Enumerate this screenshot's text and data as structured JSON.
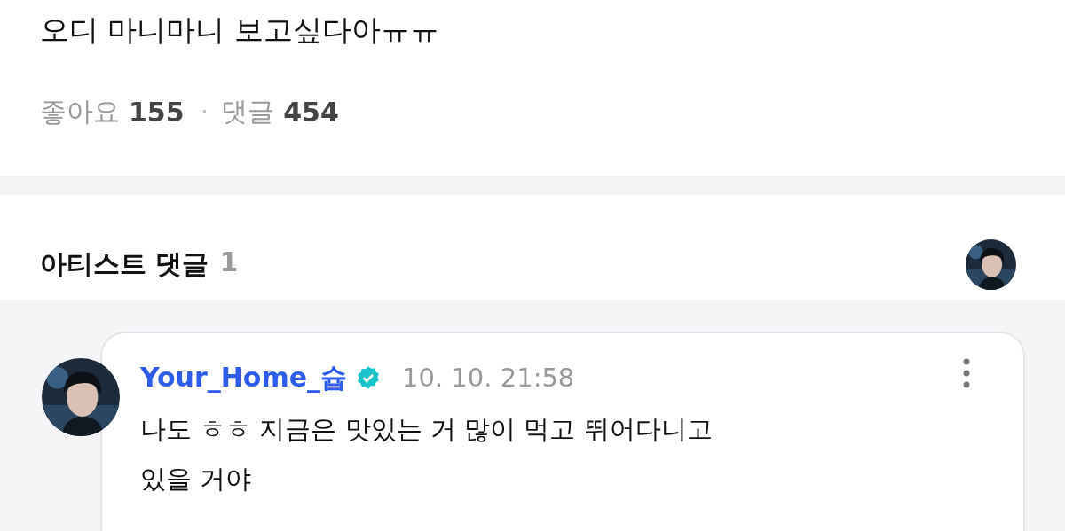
{
  "post": {
    "text": "오디 마니마니 보고싶다아ㅠㅠ",
    "stats": [
      {
        "label": "좋아요",
        "count": "155"
      },
      {
        "label": "댓글",
        "count": "454"
      }
    ],
    "separator": "·"
  },
  "artist_comments": {
    "title": "아티스트 댓글",
    "count": "1",
    "comments": [
      {
        "author": "Your_Home_슙",
        "verified": true,
        "time": "10. 10. 21:58",
        "text": "나도 ㅎㅎ 지금은 맛있는 거 많이 먹고 뛰어다니고 있을 거야"
      }
    ]
  }
}
